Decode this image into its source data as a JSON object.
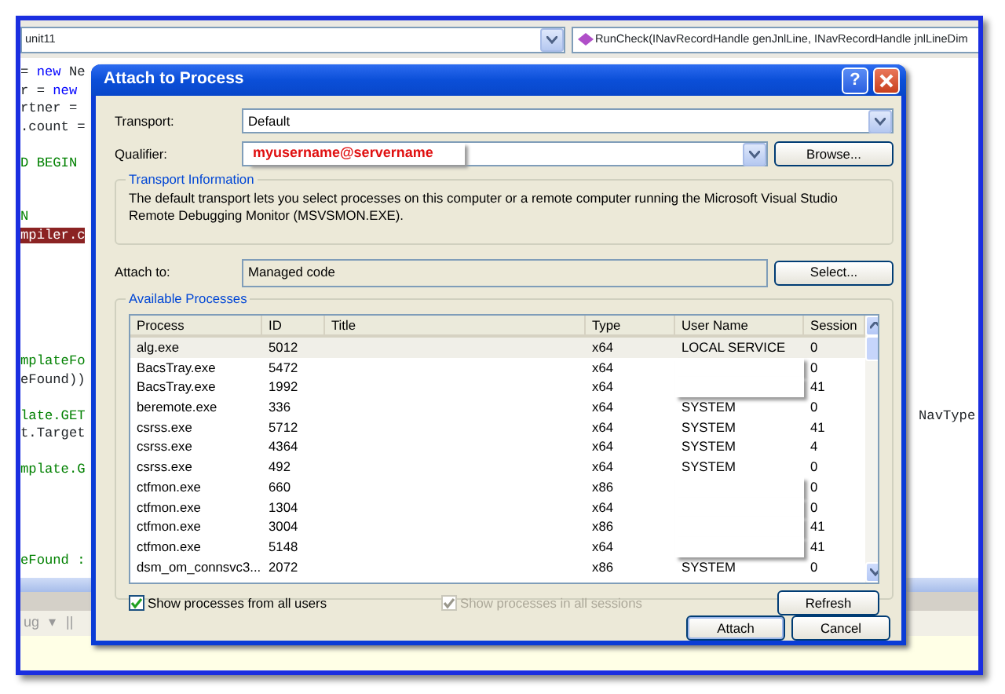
{
  "editor": {
    "class_combo": "unit11",
    "member_combo": "RunCheck(INavRecordHandle genJnlLine, INavRecordHandle jnlLineDim",
    "lines": [
      {
        "kind": "code",
        "parts": [
          {
            "text": "= ",
            "kind": "plain"
          },
          {
            "text": "new",
            "kind": "keyword"
          },
          {
            "text": " Ne",
            "kind": "plain"
          }
        ]
      },
      {
        "kind": "code",
        "parts": [
          {
            "text": "r = ",
            "kind": "plain"
          },
          {
            "text": "new",
            "kind": "keyword"
          }
        ]
      },
      {
        "kind": "code",
        "parts": [
          {
            "text": "rtner = ",
            "kind": "plain"
          }
        ]
      },
      {
        "kind": "code",
        "parts": [
          {
            "text": ".count =",
            "kind": "plain"
          }
        ]
      },
      {
        "kind": "blank"
      },
      {
        "kind": "code",
        "parts": [
          {
            "text": "D BEGIN",
            "kind": "comment"
          }
        ]
      },
      {
        "kind": "blank"
      },
      {
        "kind": "blank"
      },
      {
        "kind": "code",
        "parts": [
          {
            "text": "N",
            "kind": "comment"
          }
        ]
      },
      {
        "kind": "code",
        "parts": [
          {
            "text": "mpiler.c",
            "kind": "highlight"
          }
        ]
      },
      {
        "kind": "blank"
      },
      {
        "kind": "blank"
      },
      {
        "kind": "blank"
      },
      {
        "kind": "blank"
      },
      {
        "kind": "blank"
      },
      {
        "kind": "blank"
      },
      {
        "kind": "code",
        "parts": [
          {
            "text": "mplateFo",
            "kind": "comment"
          }
        ]
      },
      {
        "kind": "code",
        "parts": [
          {
            "text": "eFound))",
            "kind": "plain"
          }
        ]
      },
      {
        "kind": "blank"
      },
      {
        "kind": "code",
        "parts": [
          {
            "text": "late.GET",
            "kind": "comment"
          }
        ],
        "right": "NavType"
      },
      {
        "kind": "code",
        "parts": [
          {
            "text": "t.Target",
            "kind": "plain"
          }
        ]
      },
      {
        "kind": "blank"
      },
      {
        "kind": "code",
        "parts": [
          {
            "text": "mplate.G",
            "kind": "comment"
          }
        ]
      },
      {
        "kind": "blank"
      },
      {
        "kind": "blank"
      },
      {
        "kind": "blank"
      },
      {
        "kind": "blank"
      },
      {
        "kind": "code",
        "parts": [
          {
            "text": "eFound :",
            "kind": "comment"
          }
        ]
      }
    ],
    "toolbar_text": "ug",
    "toolbar_caret": "▾",
    "toolbar_pause": "||"
  },
  "dialog": {
    "title": "Attach to Process",
    "help": "?",
    "transport": {
      "label": "Transport:",
      "value": "Default"
    },
    "qualifier": {
      "label": "Qualifier:",
      "value": "myusername@servername",
      "browse": "Browse..."
    },
    "transport_info": {
      "legend": "Transport Information",
      "text": "The default transport lets you select processes on this computer or a remote computer running the Microsoft Visual Studio Remote Debugging Monitor (MSVSMON.EXE)."
    },
    "attach_to": {
      "label": "Attach to:",
      "value": "Managed code",
      "button": "Select..."
    },
    "processes": {
      "legend": "Available Processes",
      "columns": [
        "Process",
        "ID",
        "Title",
        "Type",
        "User Name",
        "Session"
      ],
      "rows": [
        {
          "process": "alg.exe",
          "id": "5012",
          "type": "x64",
          "user": "LOCAL SERVICE",
          "session": "0",
          "selected": true,
          "redacted": false
        },
        {
          "process": "BacsTray.exe",
          "id": "5472",
          "type": "x64",
          "session": "0",
          "selected": false,
          "redacted": true
        },
        {
          "process": "BacsTray.exe",
          "id": "1992",
          "type": "x64",
          "session": "41",
          "selected": false,
          "redacted": true
        },
        {
          "process": "beremote.exe",
          "id": "336",
          "type": "x64",
          "user": "SYSTEM",
          "session": "0",
          "selected": false,
          "redacted": false
        },
        {
          "process": "csrss.exe",
          "id": "5712",
          "type": "x64",
          "user": "SYSTEM",
          "session": "41",
          "selected": false,
          "redacted": false
        },
        {
          "process": "csrss.exe",
          "id": "4364",
          "type": "x64",
          "user": "SYSTEM",
          "session": "4",
          "selected": false,
          "redacted": false
        },
        {
          "process": "csrss.exe",
          "id": "492",
          "type": "x64",
          "user": "SYSTEM",
          "session": "0",
          "selected": false,
          "redacted": false
        },
        {
          "process": "ctfmon.exe",
          "id": "660",
          "type": "x86",
          "session": "0",
          "selected": false,
          "redacted": true
        },
        {
          "process": "ctfmon.exe",
          "id": "1304",
          "type": "x64",
          "session": "0",
          "selected": false,
          "redacted": true
        },
        {
          "process": "ctfmon.exe",
          "id": "3004",
          "type": "x86",
          "session": "41",
          "selected": false,
          "redacted": true
        },
        {
          "process": "ctfmon.exe",
          "id": "5148",
          "type": "x64",
          "session": "41",
          "selected": false,
          "redacted": true
        },
        {
          "process": "dsm_om_connsvc3...",
          "id": "2072",
          "type": "x86",
          "user": "SYSTEM",
          "session": "0",
          "selected": false,
          "redacted": false
        }
      ],
      "options": [
        {
          "label": "Show processes from all users",
          "checked": true,
          "disabled": false
        },
        {
          "label": "Show processes in all sessions",
          "checked": true,
          "disabled": true
        }
      ],
      "refresh": "Refresh"
    },
    "buttons": [
      "Attach",
      "Cancel"
    ]
  }
}
